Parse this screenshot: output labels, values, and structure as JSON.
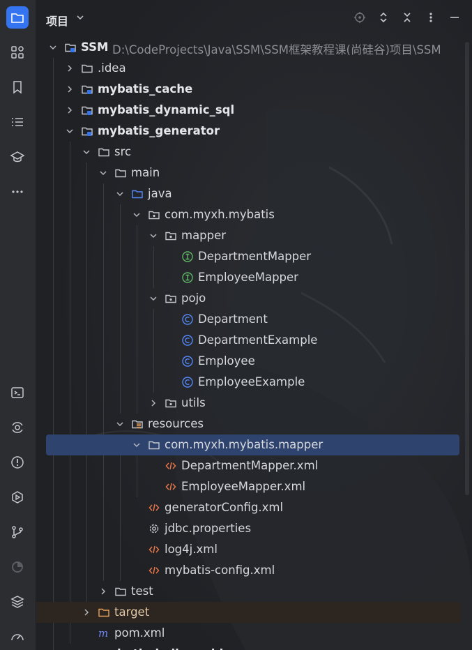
{
  "panel": {
    "title": "项目"
  },
  "rail_top": [
    {
      "icon": "folder-icon",
      "name": "rail-project",
      "active": true
    },
    {
      "icon": "structure-icon",
      "name": "rail-structure"
    },
    {
      "icon": "bookmark-icon",
      "name": "rail-bookmarks"
    },
    {
      "icon": "list-icon",
      "name": "rail-todo"
    },
    {
      "icon": "learn-icon",
      "name": "rail-learn"
    },
    {
      "icon": "more-icon",
      "name": "rail-more"
    }
  ],
  "rail_bottom": [
    {
      "icon": "terminal-icon",
      "name": "rail-terminal"
    },
    {
      "icon": "services-icon",
      "name": "rail-services"
    },
    {
      "icon": "problems-icon",
      "name": "rail-problems"
    },
    {
      "icon": "run-icon",
      "name": "rail-run"
    },
    {
      "icon": "git-icon",
      "name": "rail-git"
    },
    {
      "icon": "profiler-icon",
      "name": "rail-profiler"
    },
    {
      "icon": "layers-icon",
      "name": "rail-layers"
    },
    {
      "icon": "gauge-icon",
      "name": "rail-gauge"
    }
  ],
  "tree": [
    {
      "label": "SSM",
      "path": "D:\\CodeProjects\\Java\\SSM\\SSM框架教程课(尚硅谷)项目\\SSM",
      "indent": 0,
      "arrow": "down",
      "icon": "module-folder-icon",
      "bold": true
    },
    {
      "label": ".idea",
      "indent": 1,
      "arrow": "right",
      "icon": "folder-icon"
    },
    {
      "label": "mybatis_cache",
      "indent": 1,
      "arrow": "right",
      "icon": "module-folder-icon",
      "bold": true
    },
    {
      "label": "mybatis_dynamic_sql",
      "indent": 1,
      "arrow": "right",
      "icon": "module-folder-icon",
      "bold": true
    },
    {
      "label": "mybatis_generator",
      "indent": 1,
      "arrow": "down",
      "icon": "module-folder-icon",
      "bold": true
    },
    {
      "label": "src",
      "indent": 2,
      "arrow": "down",
      "icon": "folder-icon"
    },
    {
      "label": "main",
      "indent": 3,
      "arrow": "down",
      "icon": "folder-icon"
    },
    {
      "label": "java",
      "indent": 4,
      "arrow": "down",
      "icon": "source-folder-icon"
    },
    {
      "label": "com.myxh.mybatis",
      "indent": 5,
      "arrow": "down",
      "icon": "package-icon"
    },
    {
      "label": "mapper",
      "indent": 6,
      "arrow": "down",
      "icon": "package-icon"
    },
    {
      "label": "DepartmentMapper",
      "indent": 7,
      "icon": "interface-icon"
    },
    {
      "label": "EmployeeMapper",
      "indent": 7,
      "icon": "interface-icon"
    },
    {
      "label": "pojo",
      "indent": 6,
      "arrow": "down",
      "icon": "package-icon"
    },
    {
      "label": "Department",
      "indent": 7,
      "icon": "class-icon"
    },
    {
      "label": "DepartmentExample",
      "indent": 7,
      "icon": "class-icon"
    },
    {
      "label": "Employee",
      "indent": 7,
      "icon": "class-icon"
    },
    {
      "label": "EmployeeExample",
      "indent": 7,
      "icon": "class-icon"
    },
    {
      "label": "utils",
      "indent": 6,
      "arrow": "right",
      "icon": "package-icon"
    },
    {
      "label": "resources",
      "indent": 4,
      "arrow": "down",
      "icon": "resources-folder-icon"
    },
    {
      "label": "com.myxh.mybatis.mapper",
      "indent": 5,
      "arrow": "down",
      "icon": "folder-icon",
      "selected": true
    },
    {
      "label": "DepartmentMapper.xml",
      "indent": 6,
      "icon": "xml-icon"
    },
    {
      "label": "EmployeeMapper.xml",
      "indent": 6,
      "icon": "xml-icon"
    },
    {
      "label": "generatorConfig.xml",
      "indent": 5,
      "icon": "xml-icon"
    },
    {
      "label": "jdbc.properties",
      "indent": 5,
      "icon": "properties-icon"
    },
    {
      "label": "log4j.xml",
      "indent": 5,
      "icon": "xml-icon"
    },
    {
      "label": "mybatis-config.xml",
      "indent": 5,
      "icon": "xml-icon"
    },
    {
      "label": "test",
      "indent": 3,
      "arrow": "right",
      "icon": "folder-icon"
    },
    {
      "label": "target",
      "indent": 2,
      "arrow": "right",
      "icon": "excluded-folder-icon",
      "excluded": true
    },
    {
      "label": "pom.xml",
      "indent": 2,
      "icon": "maven-icon"
    },
    {
      "label": "mybatis_helloworld",
      "indent": 1,
      "arrow": "right",
      "icon": "module-folder-icon",
      "bold": true
    }
  ],
  "colors": {
    "accent": "#3574f0",
    "selection": "#2e436e",
    "interface": "#5fb865",
    "class": "#548af7",
    "xml": "#e8754a",
    "excluded": "#e8a25e"
  }
}
